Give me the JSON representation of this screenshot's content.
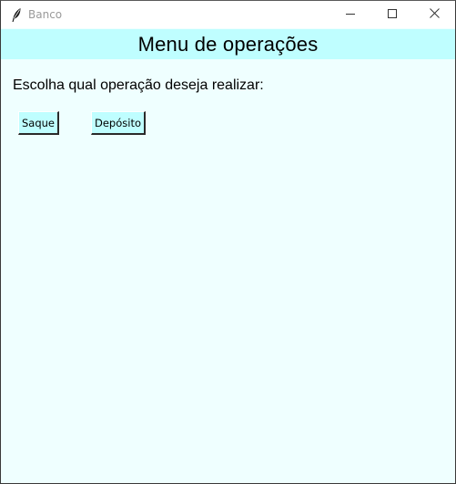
{
  "window": {
    "title": "Banco",
    "icon": "feather-icon",
    "controls": [
      "minimize-icon",
      "maximize-icon",
      "close-icon"
    ]
  },
  "header": {
    "title": "Menu de operações",
    "background": "#bffeff"
  },
  "main": {
    "prompt": "Escolha qual operação deseja realizar:",
    "background": "#efffff",
    "buttons": [
      {
        "label": "Saque"
      },
      {
        "label": "Depósito"
      }
    ]
  }
}
